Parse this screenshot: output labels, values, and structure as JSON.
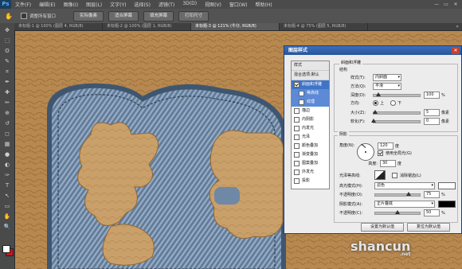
{
  "app": {
    "logo": "Ps"
  },
  "menu": [
    "文件(F)",
    "编辑(E)",
    "图像(I)",
    "图层(L)",
    "文字(Y)",
    "选择(S)",
    "滤镜(T)",
    "3D(D)",
    "视图(V)",
    "窗口(W)",
    "帮助(H)"
  ],
  "window_controls": [
    "—",
    "▭",
    "✕"
  ],
  "options": {
    "checkbox_label": "调整所有窗口",
    "buttons": [
      "实际像素",
      "适合屏幕",
      "填充屏幕",
      "打印尺寸"
    ]
  },
  "tabs": [
    "未标题-1 @ 100% (图层 4, RGB/8)",
    "未标题-2 @ 100% (图层 1, RGB/8)",
    "未标题-3 @ 121% (牛仔, RGB/8)",
    "未标题-4 @ 75% (图层 5, RGB/8)"
  ],
  "tabs_more": "»",
  "tools": [
    "move-icon",
    "marquee-icon",
    "lasso-icon",
    "quick-select-icon",
    "crop-icon",
    "eyedropper-icon",
    "healing-icon",
    "brush-icon",
    "stamp-icon",
    "history-brush-icon",
    "eraser-icon",
    "gradient-icon",
    "blur-icon",
    "dodge-icon",
    "pen-icon",
    "type-icon",
    "path-select-icon",
    "shape-icon",
    "hand-icon",
    "zoom-icon"
  ],
  "tool_glyphs": [
    "✥",
    "⬚",
    "ʘ",
    "✎",
    "⌗",
    "✒",
    "✚",
    "✏",
    "⊕",
    "↺",
    "◻",
    "▦",
    "●",
    "◐",
    "✑",
    "T",
    "↖",
    "▭",
    "✋",
    "🔍"
  ],
  "dialog": {
    "title": "图层样式",
    "close": "✕",
    "style_list": [
      {
        "label": "样式",
        "type": "head"
      },
      {
        "label": "混合选项:默认",
        "type": "head"
      },
      {
        "label": "斜面和浮雕",
        "type": "sel",
        "checked": true
      },
      {
        "label": "等高线",
        "type": "sub",
        "checked": false
      },
      {
        "label": "纹理",
        "type": "sub",
        "checked": false
      },
      {
        "label": "描边",
        "type": "plain",
        "checked": false
      },
      {
        "label": "内阴影",
        "type": "plain",
        "checked": false
      },
      {
        "label": "内发光",
        "type": "plain",
        "checked": false
      },
      {
        "label": "光泽",
        "type": "plain",
        "checked": false
      },
      {
        "label": "颜色叠加",
        "type": "plain",
        "checked": false
      },
      {
        "label": "渐变叠加",
        "type": "plain",
        "checked": false
      },
      {
        "label": "图案叠加",
        "type": "plain",
        "checked": false
      },
      {
        "label": "外发光",
        "type": "plain",
        "checked": false
      },
      {
        "label": "投影",
        "type": "plain",
        "checked": false
      }
    ],
    "bevel": {
      "section_title": "斜面和浮雕",
      "structure_label": "结构",
      "style_label": "样式(T):",
      "style_value": "内斜面",
      "method_label": "方法(Q):",
      "method_value": "平滑",
      "depth_label": "深度(D):",
      "depth_value": "100",
      "depth_unit": "%",
      "depth_fraction": 0.1,
      "direction_label": "方向:",
      "dir_up": "上",
      "dir_down": "下",
      "size_label": "大小(Z):",
      "size_value": "5",
      "size_unit": "像素",
      "size_fraction": 0.04,
      "soften_label": "软化(F):",
      "soften_value": "0",
      "soften_unit": "像素",
      "soften_fraction": 0.0
    },
    "shading": {
      "label": "阴影",
      "angle_label": "角度(N):",
      "angle_value": "120",
      "angle_unit": "度",
      "global_light_label": "使用全局光(G)",
      "altitude_label": "高度:",
      "altitude_value": "30",
      "altitude_unit": "度",
      "gloss_label": "光泽等高线:",
      "antialias_label": "消除锯齿(L)",
      "highlight_mode_label": "高光模式(H):",
      "highlight_mode_value": "滤色",
      "highlight_color": "#ffffff",
      "highlight_opacity_label": "不透明度(O):",
      "highlight_opacity_value": "75",
      "highlight_opacity_fraction": 0.75,
      "shadow_mode_label": "阴影模式(A):",
      "shadow_mode_value": "正片叠底",
      "shadow_color": "#000000",
      "shadow_opacity_label": "不透明度(C):",
      "shadow_opacity_value": "50",
      "shadow_opacity_fraction": 0.5,
      "opacity_unit": "%"
    },
    "buttons": {
      "set_default": "设置为默认值",
      "reset_default": "复位为默认值"
    }
  },
  "watermark": {
    "text": "shancun",
    "sub": ".net"
  }
}
